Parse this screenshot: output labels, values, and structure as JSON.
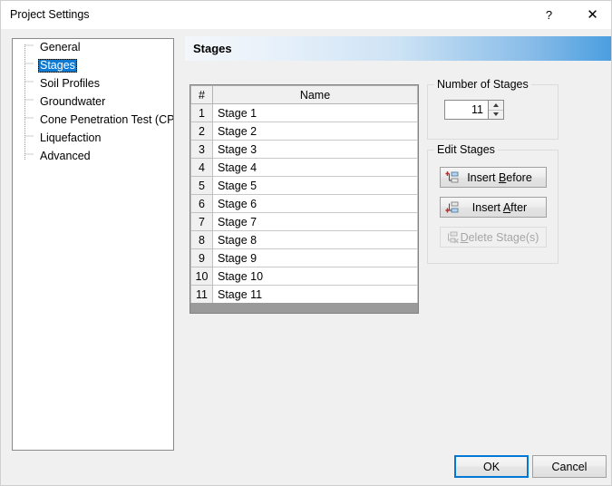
{
  "window": {
    "title": "Project Settings",
    "help_glyph": "?",
    "close_glyph": "✕"
  },
  "sidebar": {
    "items": [
      {
        "label": "General",
        "selected": false
      },
      {
        "label": "Stages",
        "selected": true
      },
      {
        "label": "Soil Profiles",
        "selected": false
      },
      {
        "label": "Groundwater",
        "selected": false
      },
      {
        "label": "Cone Penetration Test (CPT)",
        "selected": false
      },
      {
        "label": "Liquefaction",
        "selected": false
      },
      {
        "label": "Advanced",
        "selected": false
      }
    ]
  },
  "banner": {
    "title": "Stages",
    "gradient_start": "#f3f7fb",
    "gradient_end": "#4a9ee0"
  },
  "table": {
    "columns": [
      "#",
      "Name"
    ],
    "rows": [
      {
        "num": "1",
        "name": "Stage 1"
      },
      {
        "num": "2",
        "name": "Stage 2"
      },
      {
        "num": "3",
        "name": "Stage 3"
      },
      {
        "num": "4",
        "name": "Stage 4"
      },
      {
        "num": "5",
        "name": "Stage 5"
      },
      {
        "num": "6",
        "name": "Stage 6"
      },
      {
        "num": "7",
        "name": "Stage 7"
      },
      {
        "num": "8",
        "name": "Stage 8"
      },
      {
        "num": "9",
        "name": "Stage 9"
      },
      {
        "num": "10",
        "name": "Stage 10"
      },
      {
        "num": "11",
        "name": "Stage 11"
      }
    ]
  },
  "number_of_stages": {
    "group_label": "Number of Stages",
    "value": "11"
  },
  "edit_stages": {
    "group_label": "Edit Stages",
    "buttons": [
      {
        "label_before": "Insert ",
        "mnemonic": "B",
        "label_after": "efore",
        "enabled": true
      },
      {
        "label_before": "Insert ",
        "mnemonic": "A",
        "label_after": "fter",
        "enabled": true
      },
      {
        "label_before": "",
        "mnemonic": "D",
        "label_after": "elete Stage(s)",
        "enabled": false
      }
    ]
  },
  "footer": {
    "ok_label": "OK",
    "cancel_label": "Cancel"
  }
}
